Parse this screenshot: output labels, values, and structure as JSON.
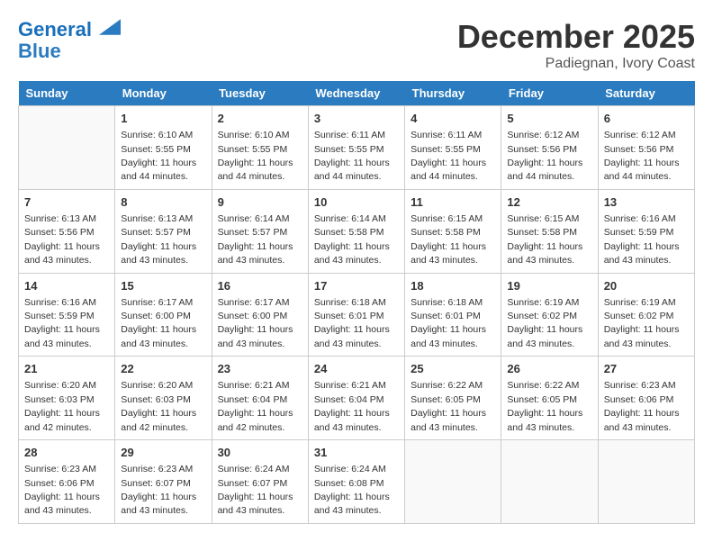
{
  "header": {
    "logo_line1": "General",
    "logo_line2": "Blue",
    "month_title": "December 2025",
    "location": "Padiegnan, Ivory Coast"
  },
  "days_of_week": [
    "Sunday",
    "Monday",
    "Tuesday",
    "Wednesday",
    "Thursday",
    "Friday",
    "Saturday"
  ],
  "weeks": [
    [
      {
        "day": "",
        "sunrise": "",
        "sunset": "",
        "daylight": ""
      },
      {
        "day": "1",
        "sunrise": "Sunrise: 6:10 AM",
        "sunset": "Sunset: 5:55 PM",
        "daylight": "Daylight: 11 hours and 44 minutes."
      },
      {
        "day": "2",
        "sunrise": "Sunrise: 6:10 AM",
        "sunset": "Sunset: 5:55 PM",
        "daylight": "Daylight: 11 hours and 44 minutes."
      },
      {
        "day": "3",
        "sunrise": "Sunrise: 6:11 AM",
        "sunset": "Sunset: 5:55 PM",
        "daylight": "Daylight: 11 hours and 44 minutes."
      },
      {
        "day": "4",
        "sunrise": "Sunrise: 6:11 AM",
        "sunset": "Sunset: 5:55 PM",
        "daylight": "Daylight: 11 hours and 44 minutes."
      },
      {
        "day": "5",
        "sunrise": "Sunrise: 6:12 AM",
        "sunset": "Sunset: 5:56 PM",
        "daylight": "Daylight: 11 hours and 44 minutes."
      },
      {
        "day": "6",
        "sunrise": "Sunrise: 6:12 AM",
        "sunset": "Sunset: 5:56 PM",
        "daylight": "Daylight: 11 hours and 44 minutes."
      }
    ],
    [
      {
        "day": "7",
        "sunrise": "Sunrise: 6:13 AM",
        "sunset": "Sunset: 5:56 PM",
        "daylight": "Daylight: 11 hours and 43 minutes."
      },
      {
        "day": "8",
        "sunrise": "Sunrise: 6:13 AM",
        "sunset": "Sunset: 5:57 PM",
        "daylight": "Daylight: 11 hours and 43 minutes."
      },
      {
        "day": "9",
        "sunrise": "Sunrise: 6:14 AM",
        "sunset": "Sunset: 5:57 PM",
        "daylight": "Daylight: 11 hours and 43 minutes."
      },
      {
        "day": "10",
        "sunrise": "Sunrise: 6:14 AM",
        "sunset": "Sunset: 5:58 PM",
        "daylight": "Daylight: 11 hours and 43 minutes."
      },
      {
        "day": "11",
        "sunrise": "Sunrise: 6:15 AM",
        "sunset": "Sunset: 5:58 PM",
        "daylight": "Daylight: 11 hours and 43 minutes."
      },
      {
        "day": "12",
        "sunrise": "Sunrise: 6:15 AM",
        "sunset": "Sunset: 5:58 PM",
        "daylight": "Daylight: 11 hours and 43 minutes."
      },
      {
        "day": "13",
        "sunrise": "Sunrise: 6:16 AM",
        "sunset": "Sunset: 5:59 PM",
        "daylight": "Daylight: 11 hours and 43 minutes."
      }
    ],
    [
      {
        "day": "14",
        "sunrise": "Sunrise: 6:16 AM",
        "sunset": "Sunset: 5:59 PM",
        "daylight": "Daylight: 11 hours and 43 minutes."
      },
      {
        "day": "15",
        "sunrise": "Sunrise: 6:17 AM",
        "sunset": "Sunset: 6:00 PM",
        "daylight": "Daylight: 11 hours and 43 minutes."
      },
      {
        "day": "16",
        "sunrise": "Sunrise: 6:17 AM",
        "sunset": "Sunset: 6:00 PM",
        "daylight": "Daylight: 11 hours and 43 minutes."
      },
      {
        "day": "17",
        "sunrise": "Sunrise: 6:18 AM",
        "sunset": "Sunset: 6:01 PM",
        "daylight": "Daylight: 11 hours and 43 minutes."
      },
      {
        "day": "18",
        "sunrise": "Sunrise: 6:18 AM",
        "sunset": "Sunset: 6:01 PM",
        "daylight": "Daylight: 11 hours and 43 minutes."
      },
      {
        "day": "19",
        "sunrise": "Sunrise: 6:19 AM",
        "sunset": "Sunset: 6:02 PM",
        "daylight": "Daylight: 11 hours and 43 minutes."
      },
      {
        "day": "20",
        "sunrise": "Sunrise: 6:19 AM",
        "sunset": "Sunset: 6:02 PM",
        "daylight": "Daylight: 11 hours and 43 minutes."
      }
    ],
    [
      {
        "day": "21",
        "sunrise": "Sunrise: 6:20 AM",
        "sunset": "Sunset: 6:03 PM",
        "daylight": "Daylight: 11 hours and 42 minutes."
      },
      {
        "day": "22",
        "sunrise": "Sunrise: 6:20 AM",
        "sunset": "Sunset: 6:03 PM",
        "daylight": "Daylight: 11 hours and 42 minutes."
      },
      {
        "day": "23",
        "sunrise": "Sunrise: 6:21 AM",
        "sunset": "Sunset: 6:04 PM",
        "daylight": "Daylight: 11 hours and 42 minutes."
      },
      {
        "day": "24",
        "sunrise": "Sunrise: 6:21 AM",
        "sunset": "Sunset: 6:04 PM",
        "daylight": "Daylight: 11 hours and 43 minutes."
      },
      {
        "day": "25",
        "sunrise": "Sunrise: 6:22 AM",
        "sunset": "Sunset: 6:05 PM",
        "daylight": "Daylight: 11 hours and 43 minutes."
      },
      {
        "day": "26",
        "sunrise": "Sunrise: 6:22 AM",
        "sunset": "Sunset: 6:05 PM",
        "daylight": "Daylight: 11 hours and 43 minutes."
      },
      {
        "day": "27",
        "sunrise": "Sunrise: 6:23 AM",
        "sunset": "Sunset: 6:06 PM",
        "daylight": "Daylight: 11 hours and 43 minutes."
      }
    ],
    [
      {
        "day": "28",
        "sunrise": "Sunrise: 6:23 AM",
        "sunset": "Sunset: 6:06 PM",
        "daylight": "Daylight: 11 hours and 43 minutes."
      },
      {
        "day": "29",
        "sunrise": "Sunrise: 6:23 AM",
        "sunset": "Sunset: 6:07 PM",
        "daylight": "Daylight: 11 hours and 43 minutes."
      },
      {
        "day": "30",
        "sunrise": "Sunrise: 6:24 AM",
        "sunset": "Sunset: 6:07 PM",
        "daylight": "Daylight: 11 hours and 43 minutes."
      },
      {
        "day": "31",
        "sunrise": "Sunrise: 6:24 AM",
        "sunset": "Sunset: 6:08 PM",
        "daylight": "Daylight: 11 hours and 43 minutes."
      },
      {
        "day": "",
        "sunrise": "",
        "sunset": "",
        "daylight": ""
      },
      {
        "day": "",
        "sunrise": "",
        "sunset": "",
        "daylight": ""
      },
      {
        "day": "",
        "sunrise": "",
        "sunset": "",
        "daylight": ""
      }
    ]
  ]
}
